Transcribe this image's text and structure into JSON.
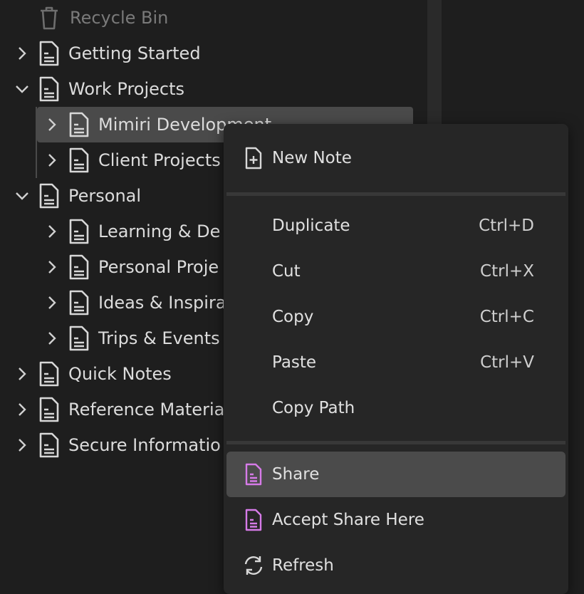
{
  "tree": {
    "recycle_bin": "Recycle Bin",
    "getting_started": "Getting Started",
    "work_projects": "Work Projects",
    "mimiri_development": "Mimiri Development",
    "client_projects": "Client Projects",
    "personal": "Personal",
    "learning": "Learning & De",
    "personal_projects": "Personal Proje",
    "ideas": "Ideas & Inspira",
    "trips": "Trips & Events",
    "quick_notes": "Quick Notes",
    "reference": "Reference Materia",
    "secure": "Secure Informatio"
  },
  "menu": {
    "new_note": "New Note",
    "duplicate": "Duplicate",
    "duplicate_shortcut": "Ctrl+D",
    "cut": "Cut",
    "cut_shortcut": "Ctrl+X",
    "copy": "Copy",
    "copy_shortcut": "Ctrl+C",
    "paste": "Paste",
    "paste_shortcut": "Ctrl+V",
    "copy_path": "Copy Path",
    "share": "Share",
    "accept_share": "Accept Share Here",
    "refresh": "Refresh"
  },
  "colors": {
    "background": "#1e1e1e",
    "menu_background": "#262626",
    "highlight": "#4b4b4b",
    "share_accent": "#d67be8"
  }
}
